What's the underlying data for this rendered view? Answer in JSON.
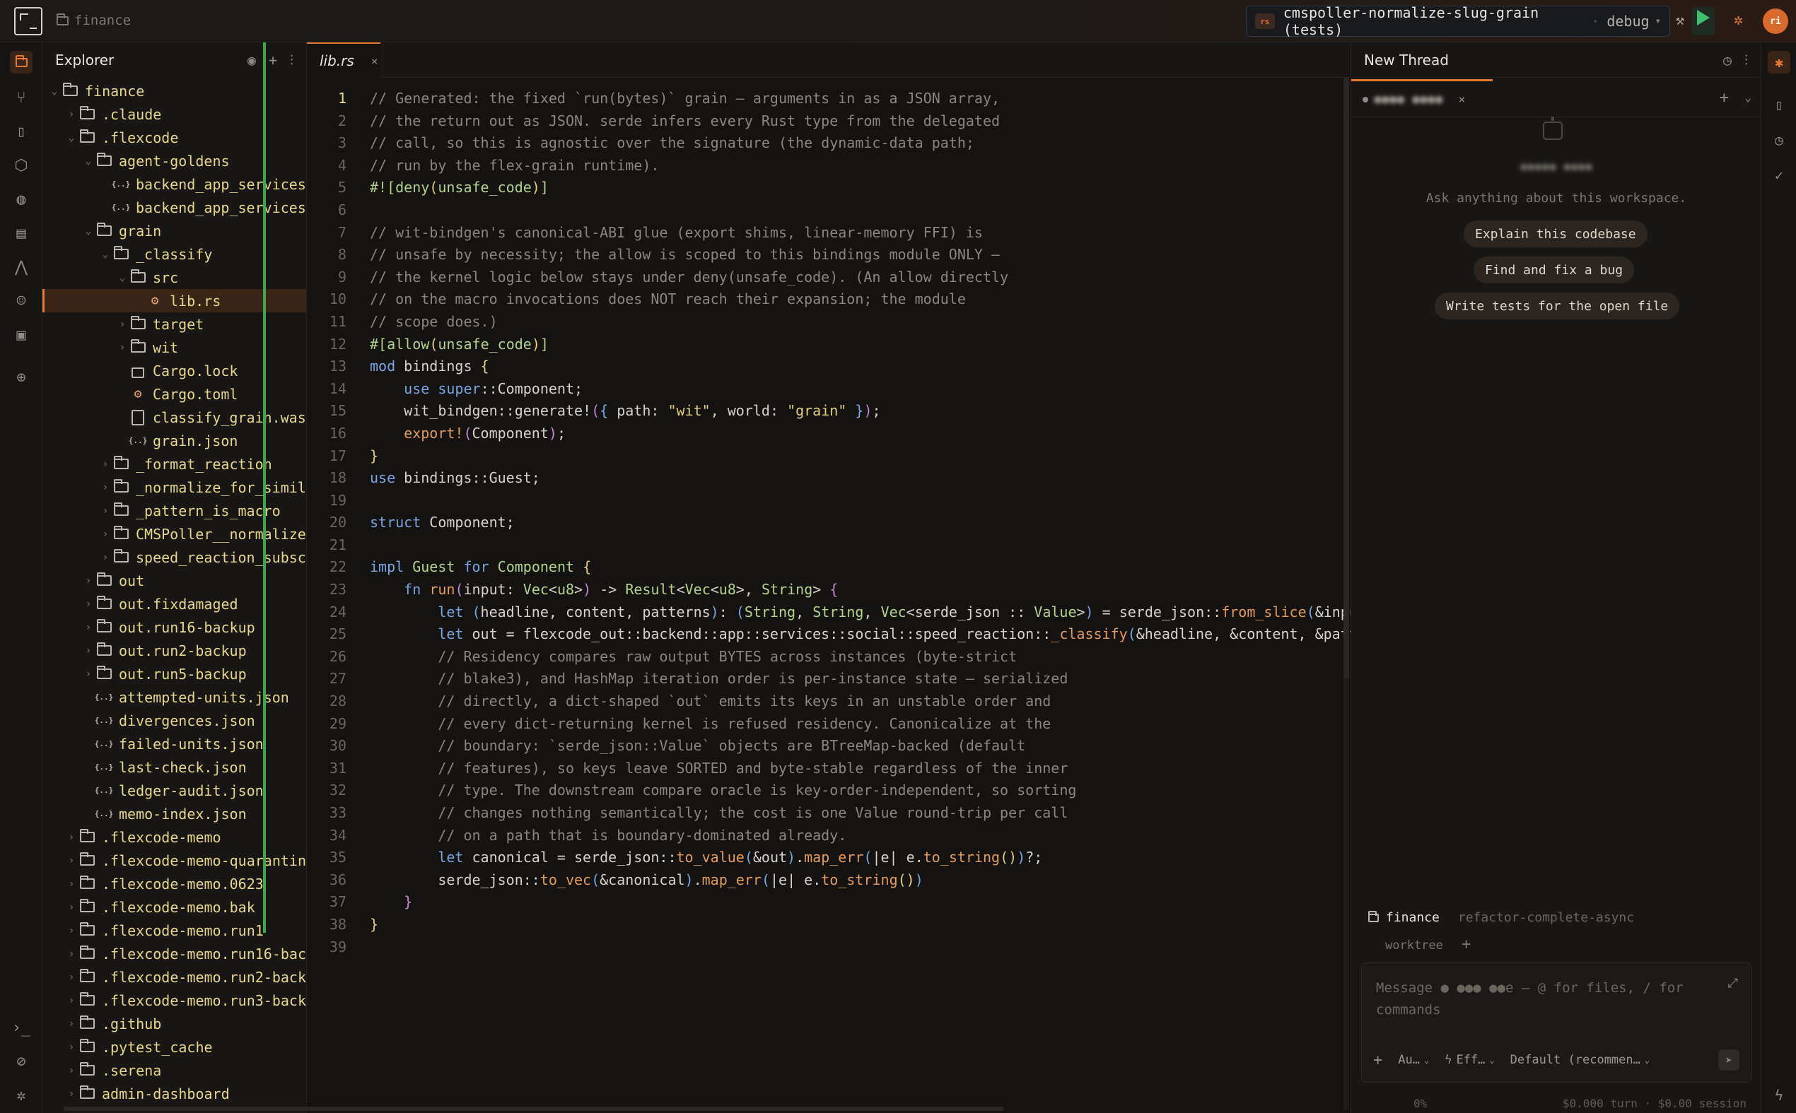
{
  "titlebar": {
    "folder": "finance",
    "run_config": {
      "lang_badge": "rs",
      "name": "cmspoller-normalize-slug-grain (tests)",
      "separator": "·",
      "mode": "debug",
      "caret": "▾"
    },
    "avatar_initials": "ri"
  },
  "activity_bar": {
    "items": [
      "folder-icon",
      "source-control-icon",
      "book-icon",
      "package-icon",
      "globe-icon",
      "database-icon",
      "graph-icon",
      "robot-icon",
      "image-icon",
      "target-icon"
    ],
    "bottom": [
      "terminal-icon",
      "status-icon",
      "bug-icon"
    ]
  },
  "explorer": {
    "title": "Explorer",
    "tree": [
      {
        "depth": 0,
        "chev": "⌄",
        "icon": "folder",
        "label": "finance"
      },
      {
        "depth": 1,
        "chev": "›",
        "icon": "folder",
        "label": ".claude"
      },
      {
        "depth": 1,
        "chev": "⌄",
        "icon": "folder",
        "label": ".flexcode"
      },
      {
        "depth": 2,
        "chev": "⌄",
        "icon": "folder",
        "label": "agent-goldens"
      },
      {
        "depth": 3,
        "chev": "",
        "icon": "json",
        "label": "backend_app_services"
      },
      {
        "depth": 3,
        "chev": "",
        "icon": "json",
        "label": "backend_app_services"
      },
      {
        "depth": 2,
        "chev": "⌄",
        "icon": "folder",
        "label": "grain"
      },
      {
        "depth": 3,
        "chev": "⌄",
        "icon": "folder",
        "label": "_classify"
      },
      {
        "depth": 4,
        "chev": "⌄",
        "icon": "folder",
        "label": "src"
      },
      {
        "depth": 5,
        "chev": "",
        "icon": "crab",
        "label": "lib.rs",
        "selected": true
      },
      {
        "depth": 4,
        "chev": "›",
        "icon": "folder",
        "label": "target"
      },
      {
        "depth": 4,
        "chev": "›",
        "icon": "folder",
        "label": "wit"
      },
      {
        "depth": 4,
        "chev": "",
        "icon": "lock",
        "label": "Cargo.lock"
      },
      {
        "depth": 4,
        "chev": "",
        "icon": "crab",
        "label": "Cargo.toml"
      },
      {
        "depth": 4,
        "chev": "",
        "icon": "file",
        "label": "classify_grain.was"
      },
      {
        "depth": 4,
        "chev": "",
        "icon": "json",
        "label": "grain.json"
      },
      {
        "depth": 3,
        "chev": "›",
        "icon": "folder",
        "label": "_format_reaction"
      },
      {
        "depth": 3,
        "chev": "›",
        "icon": "folder",
        "label": "_normalize_for_simil"
      },
      {
        "depth": 3,
        "chev": "›",
        "icon": "folder",
        "label": "_pattern_is_macro"
      },
      {
        "depth": 3,
        "chev": "›",
        "icon": "folder",
        "label": "CMSPoller__normalize"
      },
      {
        "depth": 3,
        "chev": "›",
        "icon": "folder",
        "label": "speed_reaction_subsc"
      },
      {
        "depth": 2,
        "chev": "›",
        "icon": "folder",
        "label": "out"
      },
      {
        "depth": 2,
        "chev": "›",
        "icon": "folder",
        "label": "out.fixdamaged"
      },
      {
        "depth": 2,
        "chev": "›",
        "icon": "folder",
        "label": "out.run16-backup"
      },
      {
        "depth": 2,
        "chev": "›",
        "icon": "folder",
        "label": "out.run2-backup"
      },
      {
        "depth": 2,
        "chev": "›",
        "icon": "folder",
        "label": "out.run5-backup"
      },
      {
        "depth": 2,
        "chev": "",
        "icon": "json",
        "label": "attempted-units.json"
      },
      {
        "depth": 2,
        "chev": "",
        "icon": "json",
        "label": "divergences.json"
      },
      {
        "depth": 2,
        "chev": "",
        "icon": "json",
        "label": "failed-units.json"
      },
      {
        "depth": 2,
        "chev": "",
        "icon": "json",
        "label": "last-check.json"
      },
      {
        "depth": 2,
        "chev": "",
        "icon": "json",
        "label": "ledger-audit.json"
      },
      {
        "depth": 2,
        "chev": "",
        "icon": "json",
        "label": "memo-index.json"
      },
      {
        "depth": 1,
        "chev": "›",
        "icon": "folder",
        "label": ".flexcode-memo"
      },
      {
        "depth": 1,
        "chev": "›",
        "icon": "folder",
        "label": ".flexcode-memo-quarantin"
      },
      {
        "depth": 1,
        "chev": "›",
        "icon": "folder",
        "label": ".flexcode-memo.0623"
      },
      {
        "depth": 1,
        "chev": "›",
        "icon": "folder",
        "label": ".flexcode-memo.bak"
      },
      {
        "depth": 1,
        "chev": "›",
        "icon": "folder",
        "label": ".flexcode-memo.run1"
      },
      {
        "depth": 1,
        "chev": "›",
        "icon": "folder",
        "label": ".flexcode-memo.run16-bac"
      },
      {
        "depth": 1,
        "chev": "›",
        "icon": "folder",
        "label": ".flexcode-memo.run2-back"
      },
      {
        "depth": 1,
        "chev": "›",
        "icon": "folder",
        "label": ".flexcode-memo.run3-back"
      },
      {
        "depth": 1,
        "chev": "›",
        "icon": "folder",
        "label": ".github"
      },
      {
        "depth": 1,
        "chev": "›",
        "icon": "folder",
        "label": ".pytest_cache"
      },
      {
        "depth": 1,
        "chev": "›",
        "icon": "folder",
        "label": ".serena"
      },
      {
        "depth": 1,
        "chev": "›",
        "icon": "folder",
        "label": "admin-dashboard"
      }
    ]
  },
  "editor": {
    "tab": {
      "label": "lib.rs",
      "close": "×"
    },
    "current_line": 1,
    "lines": [
      [
        [
          "c",
          "// Generated: the fixed `run(bytes)` grain — arguments in as a JSON array,"
        ]
      ],
      [
        [
          "c",
          "// the return out as JSON. serde infers every Rust type from the delegated"
        ]
      ],
      [
        [
          "c",
          "// call, so this is agnostic over the signature (the dynamic-data path;"
        ]
      ],
      [
        [
          "c",
          "// run by the flex-grain runtime)."
        ]
      ],
      [
        [
          "a",
          "#!["
        ],
        [
          "a",
          "deny"
        ],
        [
          "b1",
          "("
        ],
        [
          "a",
          "unsafe_code"
        ],
        [
          "b1",
          ")"
        ],
        [
          "a",
          "]"
        ]
      ],
      [],
      [
        [
          "c",
          "// wit-bindgen's canonical-ABI glue (export shims, linear-memory FFI) is"
        ]
      ],
      [
        [
          "c",
          "// unsafe by necessity; the allow is scoped to this bindings module ONLY —"
        ]
      ],
      [
        [
          "c",
          "// the kernel logic below stays under deny(unsafe_code). (An allow directly"
        ]
      ],
      [
        [
          "c",
          "// on the macro invocations does NOT reach their expansion; the module"
        ]
      ],
      [
        [
          "c",
          "// scope does.)"
        ]
      ],
      [
        [
          "a",
          "#["
        ],
        [
          "a",
          "allow"
        ],
        [
          "b1",
          "("
        ],
        [
          "a",
          "unsafe_code"
        ],
        [
          "b1",
          ")"
        ],
        [
          "a",
          "]"
        ]
      ],
      [
        [
          "k",
          "mod"
        ],
        [
          "p",
          " bindings "
        ],
        [
          "b1",
          "{"
        ]
      ],
      [
        [
          "p",
          "    "
        ],
        [
          "k",
          "use"
        ],
        [
          "p",
          " "
        ],
        [
          "k",
          "super"
        ],
        [
          "p",
          "::Component;"
        ]
      ],
      [
        [
          "p",
          "    wit_bindgen::generate!"
        ],
        [
          "b2",
          "("
        ],
        [
          "b3",
          "{"
        ],
        [
          "p",
          " path: "
        ],
        [
          "s",
          "\"wit\""
        ],
        [
          "p",
          ", world: "
        ],
        [
          "s",
          "\"grain\""
        ],
        [
          "p",
          " "
        ],
        [
          "b3",
          "}"
        ],
        [
          "b2",
          ")"
        ],
        [
          "p",
          ";"
        ]
      ],
      [
        [
          "p",
          "    "
        ],
        [
          "m",
          "export!"
        ],
        [
          "b2",
          "("
        ],
        [
          "p",
          "Component"
        ],
        [
          "b2",
          ")"
        ],
        [
          "p",
          ";"
        ]
      ],
      [
        [
          "b1",
          "}"
        ]
      ],
      [
        [
          "k",
          "use"
        ],
        [
          "p",
          " bindings::Guest;"
        ]
      ],
      [],
      [
        [
          "k",
          "struct"
        ],
        [
          "p",
          " Component;"
        ]
      ],
      [],
      [
        [
          "k",
          "impl"
        ],
        [
          "p",
          " "
        ],
        [
          "t",
          "Guest"
        ],
        [
          "p",
          " "
        ],
        [
          "k",
          "for"
        ],
        [
          "p",
          " "
        ],
        [
          "t",
          "Component"
        ],
        [
          "p",
          " "
        ],
        [
          "b1",
          "{"
        ]
      ],
      [
        [
          "p",
          "    "
        ],
        [
          "k",
          "fn"
        ],
        [
          "p",
          " "
        ],
        [
          "f",
          "run"
        ],
        [
          "b2",
          "("
        ],
        [
          "p",
          "input: "
        ],
        [
          "t",
          "Vec"
        ],
        [
          "p",
          "<"
        ],
        [
          "t",
          "u8"
        ],
        [
          "p",
          ">"
        ],
        [
          "b2",
          ")"
        ],
        [
          "p",
          " -> "
        ],
        [
          "t",
          "Result"
        ],
        [
          "p",
          "<"
        ],
        [
          "t",
          "Vec"
        ],
        [
          "p",
          "<"
        ],
        [
          "t",
          "u8"
        ],
        [
          "p",
          ">, "
        ],
        [
          "t",
          "String"
        ],
        [
          "p",
          "> "
        ],
        [
          "b2",
          "{"
        ]
      ],
      [
        [
          "p",
          "        "
        ],
        [
          "k",
          "let"
        ],
        [
          "p",
          " "
        ],
        [
          "b3",
          "("
        ],
        [
          "p",
          "headline, content, patterns"
        ],
        [
          "b3",
          ")"
        ],
        [
          "p",
          ": "
        ],
        [
          "b3",
          "("
        ],
        [
          "t",
          "String"
        ],
        [
          "p",
          ", "
        ],
        [
          "t",
          "String"
        ],
        [
          "p",
          ", "
        ],
        [
          "t",
          "Vec"
        ],
        [
          "p",
          "<serde_json :: "
        ],
        [
          "t",
          "Value"
        ],
        [
          "p",
          ">"
        ],
        [
          "b3",
          ")"
        ],
        [
          "p",
          " = serde_json::"
        ],
        [
          "f",
          "from_slice"
        ],
        [
          "b3",
          "("
        ],
        [
          "p",
          "&input"
        ],
        [
          "b3",
          ")"
        ],
        [
          "p",
          "."
        ]
      ],
      [
        [
          "p",
          "        "
        ],
        [
          "k",
          "let"
        ],
        [
          "p",
          " out = flexcode_out::backend::app::services::social::speed_reaction::"
        ],
        [
          "f",
          "_classify"
        ],
        [
          "b3",
          "("
        ],
        [
          "p",
          "&headline, &content, &pattern"
        ]
      ],
      [
        [
          "c",
          "        // Residency compares raw output BYTES across instances (byte-strict"
        ]
      ],
      [
        [
          "c",
          "        // blake3), and HashMap iteration order is per-instance state — serialized"
        ]
      ],
      [
        [
          "c",
          "        // directly, a dict-shaped `out` emits its keys in an unstable order and"
        ]
      ],
      [
        [
          "c",
          "        // every dict-returning kernel is refused residency. Canonicalize at the"
        ]
      ],
      [
        [
          "c",
          "        // boundary: `serde_json::Value` objects are BTreeMap-backed (default"
        ]
      ],
      [
        [
          "c",
          "        // features), so keys leave SORTED and byte-stable regardless of the inner"
        ]
      ],
      [
        [
          "c",
          "        // type. The downstream compare oracle is key-order-independent, so sorting"
        ]
      ],
      [
        [
          "c",
          "        // changes nothing semantically; the cost is one Value round-trip per call"
        ]
      ],
      [
        [
          "c",
          "        // on a path that is boundary-dominated already."
        ]
      ],
      [
        [
          "p",
          "        "
        ],
        [
          "k",
          "let"
        ],
        [
          "p",
          " canonical = serde_json::"
        ],
        [
          "f",
          "to_value"
        ],
        [
          "b3",
          "("
        ],
        [
          "p",
          "&out"
        ],
        [
          "b3",
          ")"
        ],
        [
          "p",
          "."
        ],
        [
          "f",
          "map_err"
        ],
        [
          "b3",
          "("
        ],
        [
          "p",
          "|e| e."
        ],
        [
          "f",
          "to_string"
        ],
        [
          "b1",
          "()"
        ],
        [
          "b3",
          ")"
        ],
        [
          "p",
          "?;"
        ]
      ],
      [
        [
          "p",
          "        serde_json::"
        ],
        [
          "f",
          "to_vec"
        ],
        [
          "b3",
          "("
        ],
        [
          "p",
          "&canonical"
        ],
        [
          "b3",
          ")"
        ],
        [
          "p",
          "."
        ],
        [
          "f",
          "map_err"
        ],
        [
          "b3",
          "("
        ],
        [
          "p",
          "|e| e."
        ],
        [
          "f",
          "to_string"
        ],
        [
          "b1",
          "()"
        ],
        [
          "b3",
          ")"
        ]
      ],
      [
        [
          "p",
          "    "
        ],
        [
          "b2",
          "}"
        ]
      ],
      [
        [
          "b1",
          "}"
        ]
      ],
      []
    ]
  },
  "chat": {
    "title": "New Thread",
    "tab": {
      "name": "●●●● ●●●●",
      "close": "×"
    },
    "agent_name": "●●●●● ●●●●",
    "subtitle": "Ask anything about this workspace.",
    "suggestions": [
      "Explain this codebase",
      "Find and fix a bug",
      "Write tests for the open file"
    ],
    "context": {
      "folder": "finance",
      "branch": "refactor-complete-async",
      "worktree": "worktree",
      "worktree_add": "+"
    },
    "composer": {
      "placeholder": "Message ● ●●● ●●e — @ for files, / for commands",
      "add": "+",
      "mode": "Au…",
      "effort": "Eff…",
      "model": "Default (recommen…",
      "caret": "⌄"
    },
    "footer": {
      "usage": "0%",
      "cost": "$0.000 turn · $0.00 session"
    }
  },
  "right_rail": {
    "items": [
      "agent-icon",
      "book-open-icon",
      "history-icon",
      "check-icon"
    ],
    "bottom": [
      "bolt-icon"
    ]
  },
  "colors": {
    "accent": "#e47a32",
    "green_gutter": "#3fa84a",
    "folder_text": "#e6d78a",
    "keyword": "#79a5e0",
    "type": "#b3d38b",
    "comment": "#8a857e",
    "string": "#e3cf7a"
  }
}
